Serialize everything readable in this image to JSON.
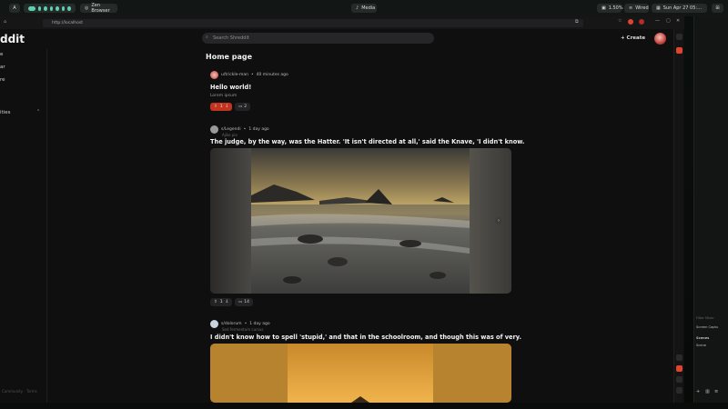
{
  "os_bar": {
    "launcher": "A",
    "app_name": "Zen Browser",
    "media_label": "Media",
    "cpu": "1.50%",
    "network": "Wired",
    "datetime": "Sun Apr 27 05:52:40 PM"
  },
  "browser": {
    "url": "http://localhost"
  },
  "app": {
    "logo": "ddit",
    "search_placeholder": "Search Shreddit",
    "create_label": "Create"
  },
  "sidebar": {
    "items": [
      "e",
      "ar",
      "re",
      "ities"
    ],
    "footer": "Community · Terms"
  },
  "feed": {
    "title": "Home page",
    "posts": [
      {
        "author": "u/trickle-man",
        "time": "40 minutes ago",
        "title": "Hello world!",
        "body": "Lorem ipsum",
        "votes": "1",
        "comments": "2"
      },
      {
        "author": "s/Legendi",
        "time": "1 day ago",
        "subtitle": "Ajiko pin",
        "title": "The judge, by the way, was the Hatter. 'It isn't directed at all,' said the Knave, 'I didn't know.",
        "votes": "1",
        "comments": "14"
      },
      {
        "author": "s/dolorum",
        "time": "1 day ago",
        "subtitle": "Sed fermentum cursus",
        "title": "I didn't know how to spell 'stupid,' and that in the schoolroom, and though this was of very."
      }
    ]
  },
  "right_panel": {
    "source_label": "Screen Captu",
    "scenes_label": "Scenes",
    "scene_item": "Scene",
    "filter_label": "Filter Mixer"
  },
  "colors": {
    "accent_teal": "#5ed0b2",
    "upvote_red": "#e0442e",
    "page_bg": "#0f0f10"
  }
}
